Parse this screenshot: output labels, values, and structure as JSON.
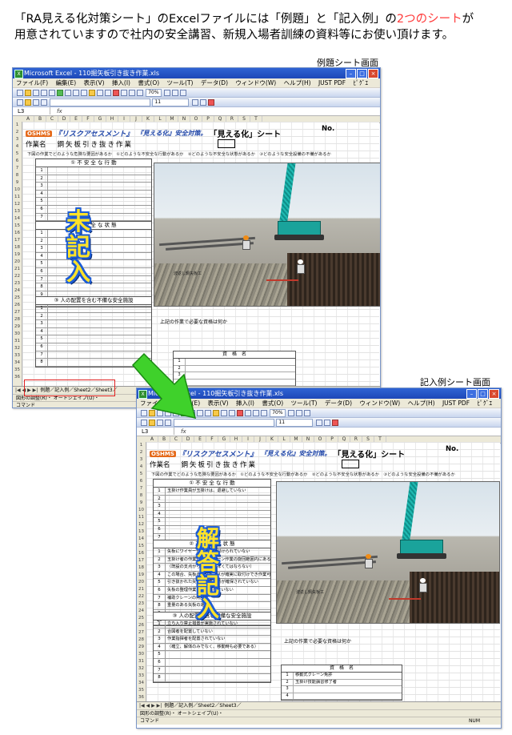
{
  "intro": {
    "line1_a": "「RA見える化対策シート」のExcelファイルには「例題」と「記入例」の",
    "line1_hl": "2つのシート",
    "line1_b": "が",
    "line2": "用意されていますので社内の安全講習、新規入場者訓練の資料等にお使い頂けます。"
  },
  "captions": {
    "example_sheet": "例題シート画面",
    "filled_sheet": "記入例シート画面"
  },
  "overlays": {
    "unfilled": [
      "未",
      "記",
      "入"
    ],
    "answer": [
      "解",
      "答",
      "記",
      "入"
    ]
  },
  "excel": {
    "title": "Microsoft Excel - 110掘矢板引き抜き作業.xls",
    "menu": [
      "ファイル(F)",
      "編集(E)",
      "表示(V)",
      "挿入(I)",
      "書式(O)",
      "ツール(T)",
      "データ(D)",
      "ウィンドウ(W)",
      "ヘルプ(H)",
      "JUST PDF",
      "ﾋﾟｸﾞｴ"
    ],
    "zoom": "70%",
    "font_size": "11",
    "name_box": "L3",
    "fx": "fx",
    "columns": [
      "A",
      "B",
      "C",
      "D",
      "E",
      "F",
      "G",
      "H",
      "I",
      "J",
      "K",
      "L",
      "M",
      "N",
      "O",
      "P",
      "Q",
      "R",
      "S",
      "T"
    ],
    "tabs_example": "例題／記入例／Sheet2／Sheet3／",
    "tabs_filled": "例題／記入例／Sheet2／Sheet3／",
    "draw_bar": "図形の調整(R)・  オートシェイプ(U)・",
    "status": "コマンド",
    "status_num": "NUM"
  },
  "sheet": {
    "logo": "OSHMS",
    "title1": "『リスクアセスメント』",
    "title2": "『見える化』安全対策。",
    "title3": "「見える化」シート",
    "no_label": "No.",
    "work_label": "作業名",
    "work_value": "鋼矢板引き抜き作業",
    "instruction": "下図の作業でどのような危険な要因があるか　①どのような不安全な行動があるか　②どのような不安全な状態があるか　③どのような安全設備の不備があるか",
    "sec1": "① 不 安 全 な 行 動",
    "sec2": "② 不 安 全 な 状 態",
    "sec3": "③ 人の配置を含む不備な安全施設",
    "photo_label": "波返し鋼矢板工",
    "question": "上記の作業で必要な資格は何か",
    "license_header": "資　格　名",
    "rows1": [
      "1",
      "2",
      "3",
      "4",
      "5",
      "6",
      "7"
    ],
    "rows2": [
      "1",
      "2",
      "3",
      "4",
      "5",
      "6",
      "7",
      "8",
      "9",
      "10"
    ],
    "rows3": [
      "1",
      "2",
      "3",
      "4",
      "5",
      "6",
      "7",
      "8"
    ],
    "lic_rows": [
      "1",
      "2",
      "3",
      "4"
    ]
  },
  "filled": {
    "sec1": [
      "玉掛け作業員が玉掛けは、退避していない",
      "",
      "",
      "",
      "",
      "",
      ""
    ],
    "sec2": [
      "矢板にワイヤーが確実に取付けられていない",
      "玉掛け者の作業位置がクレーン作業の旋回範囲内にある",
      "（既設の支点から引き上げなくてはならない）",
      "この場合、矢板の吊りピースが確実に取付けでき作業可能であると",
      "引き抜かれた矢板の仮置場所が確保されていない",
      "矢板の整理作業が実施されていない",
      "補助クレーンの無回収",
      "重量のある矢板の運搬",
      "",
      ""
    ],
    "sec3": [
      "立ち入り禁止措置が実施されていない",
      "合図者を配置していない",
      "作業指揮者を配置されていない",
      "（確立、解体のみでなく、移動時も必要である）",
      "",
      "",
      "",
      ""
    ],
    "licenses": [
      "移動式クレーン免許",
      "玉掛け技能講習修了者",
      "",
      ""
    ]
  }
}
